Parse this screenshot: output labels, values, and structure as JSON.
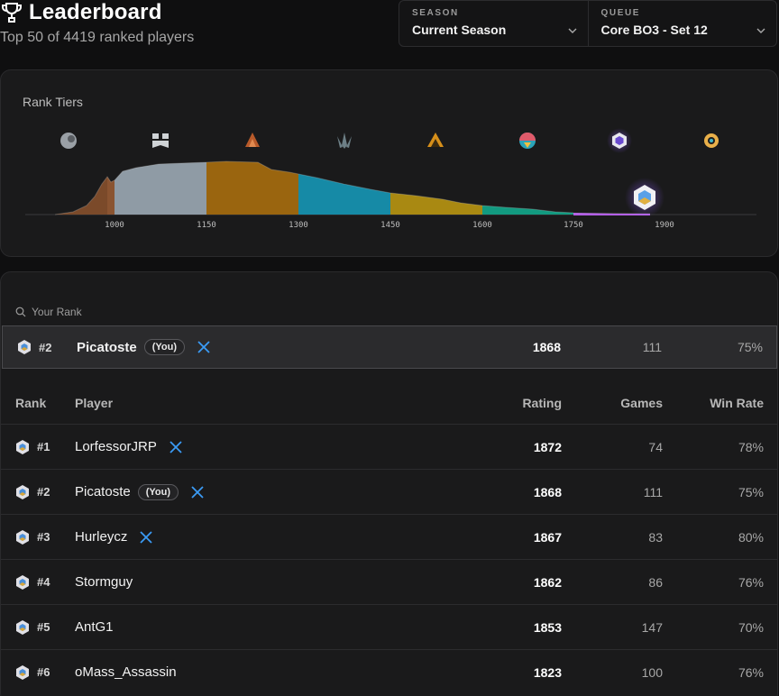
{
  "header": {
    "title": "Leaderboard",
    "subtitle": "Top 50 of 4419 ranked players"
  },
  "selectors": {
    "season_label": "SEASON",
    "season_value": "Current Season",
    "queue_label": "QUEUE",
    "queue_value": "Core BO3 - Set 12"
  },
  "rank_tiers": {
    "title": "Rank Tiers",
    "tier_icons": [
      "iron-tier-icon",
      "bronze-tier-icon",
      "silver-tier-icon",
      "gold-tier-icon",
      "platinum-tier-icon",
      "diamond-tier-icon",
      "master-tier-icon",
      "champion-tier-icon"
    ],
    "axis_ticks": [
      "1000",
      "1150",
      "1300",
      "1450",
      "1600",
      "1750",
      "1900"
    ]
  },
  "your_rank": {
    "label": "Your Rank",
    "rank": "#2",
    "player": "Picatoste",
    "you_badge": "(You)",
    "rating": "1868",
    "games": "111",
    "win_rate": "75%"
  },
  "table": {
    "headers": {
      "rank": "Rank",
      "player": "Player",
      "rating": "Rating",
      "games": "Games",
      "win_rate": "Win Rate"
    },
    "rows": [
      {
        "rank": "#1",
        "player": "LorfessorJRP",
        "you": "",
        "rating": "1872",
        "games": "74",
        "win_rate": "78%"
      },
      {
        "rank": "#2",
        "player": "Picatoste",
        "you": "(You)",
        "rating": "1868",
        "games": "111",
        "win_rate": "75%"
      },
      {
        "rank": "#3",
        "player": "Hurleycz",
        "you": "",
        "rating": "1867",
        "games": "83",
        "win_rate": "80%"
      },
      {
        "rank": "#4",
        "player": "Stormguy",
        "you": "",
        "rating": "1862",
        "games": "86",
        "win_rate": "76%"
      },
      {
        "rank": "#5",
        "player": "AntG1",
        "you": "",
        "rating": "1853",
        "games": "147",
        "win_rate": "70%"
      },
      {
        "rank": "#6",
        "player": "oMass_Assassin",
        "you": "",
        "rating": "1823",
        "games": "100",
        "win_rate": "76%"
      }
    ]
  },
  "colors": {
    "iron": "#9aa0a6",
    "bronze": "#b06a3a",
    "silver": "#7f8a94",
    "gold": "#a16a10",
    "platinum": "#1a93b0",
    "diamond": "#b8900e",
    "master": "#14a58a",
    "grandmaster": "#b35ee6"
  }
}
